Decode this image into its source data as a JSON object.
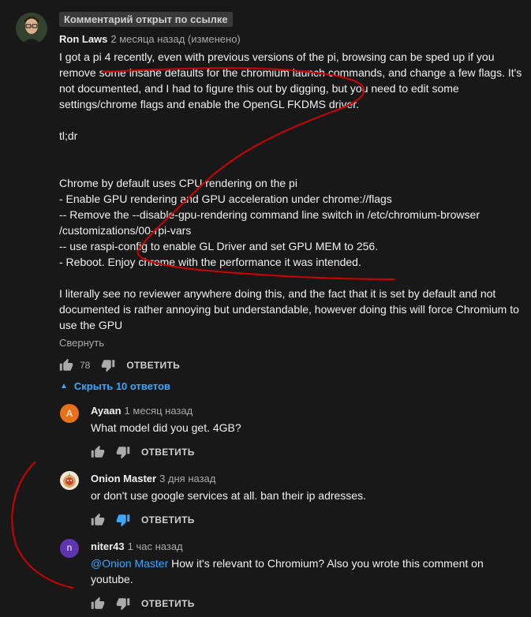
{
  "badge": "Комментарий открыт по ссылке",
  "main": {
    "author": "Ron Laws",
    "time": "2 месяца назад (изменено)",
    "lines": [
      "I got a pi 4 recently, even with previous versions of the pi, browsing can be sped up if you",
      "remove some insane defaults for the chromium launch commands, and change a few flags. It's",
      "not documented, and I had to figure this out by digging, but you need to edit some",
      "settings/chrome flags and enable the OpenGL FKDMS driver.",
      "",
      "tl;dr",
      "",
      "",
      "Chrome by default uses CPU rendering on the pi",
      "- Enable GPU rendering and GPU acceleration under chrome://flags",
      "-- Remove the --disable-gpu-rendering command line switch in /etc/chromium-browser",
      "/customizations/00-rpi-vars",
      "-- use raspi-config to enable GL Driver and set GPU MEM to 256.",
      "- Reboot. Enjoy chrome with the performance it was intended.",
      "",
      "I literally see no reviewer anywhere doing this, and the fact that it is set by default and not",
      "documented is rather annoying but understandable, however doing this will force Chromium to",
      "use the GPU"
    ],
    "collapse": "Свернуть",
    "likes": "78",
    "reply": "ОТВЕТИТЬ",
    "hide_replies": "Скрыть 10 ответов"
  },
  "replies": [
    {
      "author": "Ayaan",
      "time": "1 месяц назад",
      "initial": "A",
      "avatar_color": "#e8711c",
      "text": "What model did you get. 4GB?",
      "reply": "ОТВЕТИТЬ"
    },
    {
      "author": "Onion Master",
      "time": "3 дня назад",
      "avatar_color": "#d9a46a",
      "text": "or don't use google services at all. ban their ip adresses.",
      "reply": "ОТВЕТИТЬ"
    },
    {
      "author": "niter43",
      "time": "1 час назад",
      "initial": "n",
      "avatar_color": "#5e35b1",
      "mention": "@Onion Master",
      "text": " How it's relevant to Chromium? Also you wrote this comment on\nyoutube.",
      "reply": "ОТВЕТИТЬ"
    }
  ],
  "colors": {
    "background": "#181818",
    "link": "#3ea6ff",
    "annotation": "#d10000"
  }
}
